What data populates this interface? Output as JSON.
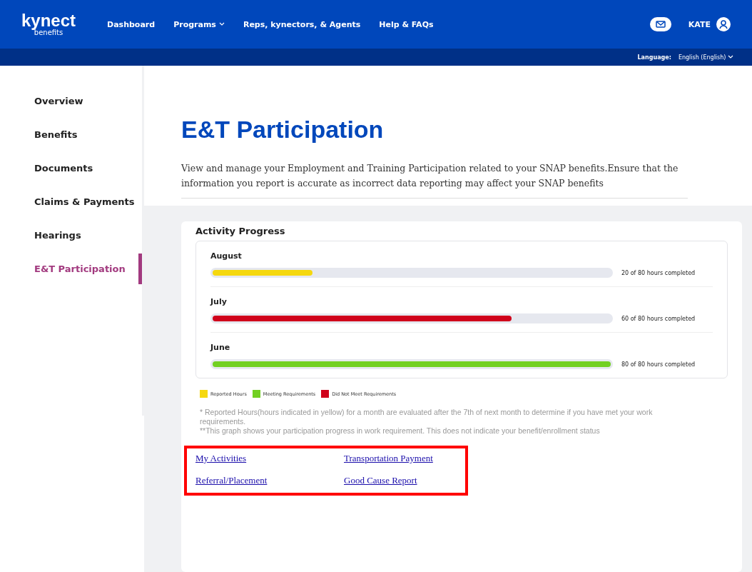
{
  "header": {
    "logo": "kynect",
    "logo_sub": "benefits",
    "nav": [
      {
        "label": "Dashboard",
        "dropdown": false
      },
      {
        "label": "Programs",
        "dropdown": true
      },
      {
        "label": "Reps, kynectors, & Agents",
        "dropdown": false
      },
      {
        "label": "Help & FAQs",
        "dropdown": false
      }
    ],
    "user": "KATE"
  },
  "language_bar": {
    "label": "Language:",
    "value": "English (English)"
  },
  "sidebar": {
    "items": [
      {
        "label": "Overview",
        "selected": false
      },
      {
        "label": "Benefits",
        "selected": false
      },
      {
        "label": "Documents",
        "selected": false
      },
      {
        "label": "Claims & Payments",
        "selected": false
      },
      {
        "label": "Hearings",
        "selected": false
      },
      {
        "label": "E&T Participation",
        "selected": true
      }
    ]
  },
  "page": {
    "title": "E&T Participation",
    "description": "View and manage your Employment and Training Participation related to your SNAP benefits.Ensure that the information you report is accurate as incorrect data reporting may affect your SNAP benefits"
  },
  "activity_progress": {
    "title": "Activity Progress",
    "months": [
      {
        "month": "August",
        "level": 0.25,
        "color": "#f5d80f",
        "reading": "20 of 80 hours completed"
      },
      {
        "month": "July",
        "level": 0.75,
        "color": "#d0021b",
        "reading": "60 of 80 hours completed"
      },
      {
        "month": "June",
        "level": 1,
        "color": "#72d022",
        "reading": "80 of 80 hours completed"
      }
    ],
    "legend": [
      {
        "label": "Reported Hours",
        "color": "#f5d80f"
      },
      {
        "label": "Meeting Requirements",
        "color": "#72d022"
      },
      {
        "label": "Did Not Meet Requirements",
        "color": "#d0021b"
      }
    ],
    "notes": [
      "* Reported Hours(hours indicated in yellow) for a month are evaluated after the 7th of next month to determine if you have met your work requirements.",
      "**This graph shows your participation progress in work requirement. This does not indicate your benefit/enrollment status"
    ]
  },
  "links": [
    "My Activities",
    "Transportation Payment",
    "Referral/Placement",
    "Good Cause Report"
  ]
}
